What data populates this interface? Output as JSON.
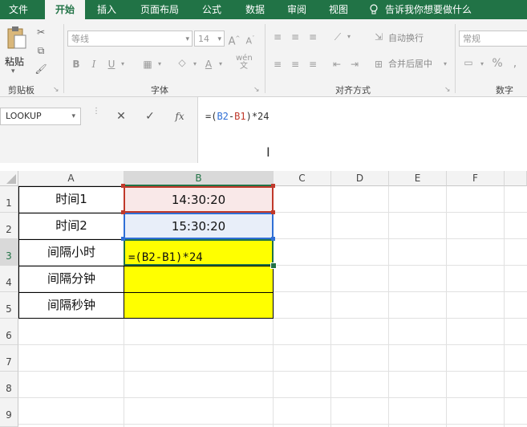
{
  "menu": {
    "tabs": [
      "文件",
      "开始",
      "插入",
      "页面布局",
      "公式",
      "数据",
      "审阅",
      "视图"
    ],
    "active": "开始",
    "tell_me": "告诉我你想要做什么"
  },
  "ribbon": {
    "clipboard": {
      "paste_label": "粘贴",
      "group_label": "剪贴板"
    },
    "font": {
      "name": "等线",
      "size": "14",
      "group_label": "字体"
    },
    "alignment": {
      "wrap_text": "自动换行",
      "merge_center": "合并后居中",
      "group_label": "对齐方式"
    },
    "number": {
      "format": "常规",
      "group_label": "数字",
      "percent": "%"
    }
  },
  "formula_bar": {
    "name_box": "LOOKUP",
    "formula": "=(B2-B1)*24",
    "fx": "fx"
  },
  "sheet": {
    "columns": [
      "A",
      "B",
      "C",
      "D",
      "E",
      "F"
    ],
    "rows": [
      "1",
      "2",
      "3",
      "4",
      "5",
      "6",
      "7",
      "8",
      "9"
    ],
    "cells": {
      "A1": "时间1",
      "B1": "14:30:20",
      "A2": "时间2",
      "B2": "15:30:20",
      "A3": "间隔小时",
      "B3": "=(B2-B1)*24",
      "A4": "间隔分钟",
      "B4": "",
      "A5": "间隔秒钟",
      "B5": ""
    }
  },
  "colors": {
    "brand": "#217346",
    "b1_fill": "#f9e8e8",
    "b2_fill": "#e8eef9",
    "highlight": "#ffff00",
    "ref_red": "#c0392b",
    "ref_blue": "#2f6fd6"
  }
}
